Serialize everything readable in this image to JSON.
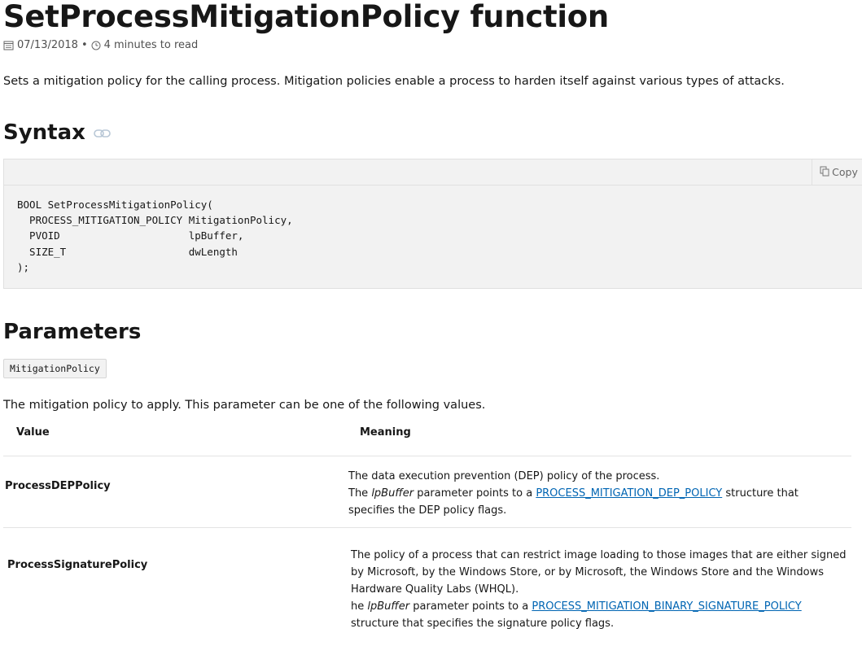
{
  "title": "SetProcessMitigationPolicy function",
  "meta": {
    "date": "07/13/2018",
    "separator": "•",
    "read_time": "4 minutes to read"
  },
  "intro": "Sets a mitigation policy for the calling process. Mitigation policies enable a process to harden itself against various types of attacks.",
  "syntax": {
    "heading": "Syntax",
    "copy_label": "Copy",
    "code": "BOOL SetProcessMitigationPolicy(\n  PROCESS_MITIGATION_POLICY MitigationPolicy,\n  PVOID                     lpBuffer,\n  SIZE_T                    dwLength\n);"
  },
  "parameters": {
    "heading": "Parameters",
    "param_name": "MitigationPolicy",
    "description": "The mitigation policy to apply. This parameter can be one of the following values.",
    "table": {
      "headers": [
        "Value",
        "Meaning"
      ],
      "rows": [
        {
          "name": "ProcessDEPPolicy",
          "line1": "The data execution prevention (DEP) policy of the process.",
          "pre": "The ",
          "param": "lpBuffer",
          "mid": " parameter points to a ",
          "link": "PROCESS_MITIGATION_DEP_POLICY",
          "post": " structure that specifies the DEP policy flags."
        },
        {
          "name": "ProcessSignaturePolicy",
          "line1": "The policy of a process that can restrict image loading to those images that are either signed by Microsoft, by the Windows Store, or by Microsoft, the Windows Store and the Windows Hardware Quality Labs (WHQL).",
          "pre": "he ",
          "param": "lpBuffer",
          "mid": " parameter points to a ",
          "link": "PROCESS_MITIGATION_BINARY_SIGNATURE_POLICY",
          "post": " structure that specifies the signature policy flags."
        }
      ]
    }
  },
  "icons": {
    "calendar": "calendar-icon",
    "clock": "clock-icon",
    "link": "permalink-icon",
    "copy": "copy-icon"
  },
  "colors": {
    "link": "#0065b3",
    "code_bg": "#f2f2f2"
  }
}
